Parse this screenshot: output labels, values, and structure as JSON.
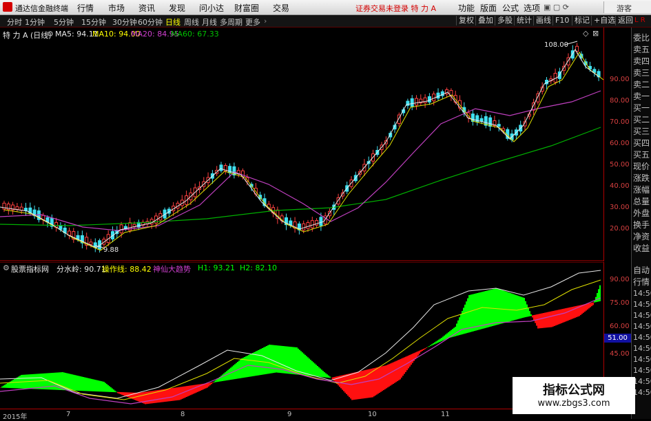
{
  "menubar": {
    "app_title": "通达信金融终端",
    "menus": [
      "行情",
      "市场",
      "资讯",
      "发现",
      "问小达",
      "财富圈",
      "交易"
    ],
    "notice": "证券交易未登录  特 力 A",
    "right_menus": [
      "功能",
      "版面",
      "公式",
      "选项"
    ],
    "guest": "游客"
  },
  "toolbar": {
    "periods": [
      "分时",
      "1分钟",
      "5分钟",
      "15分钟",
      "30分钟",
      "60分钟",
      "日线",
      "周线",
      "月线",
      "多周期",
      "更多"
    ],
    "active_period": "日线",
    "right_buttons": [
      "复权",
      "叠加",
      "多股",
      "统计",
      "画线",
      "F10",
      "标记",
      "+自选",
      "返回"
    ]
  },
  "main_chart": {
    "stock": "特 力 A (日线)",
    "ma": [
      {
        "label": "MA5: 94.11",
        "color": "#e8e8e8"
      },
      {
        "label": "MA10: 94.00",
        "color": "#ffff00"
      },
      {
        "label": "MA20: 84.95",
        "color": "#d040d0"
      },
      {
        "label": "MA60: 67.33",
        "color": "#00c000"
      }
    ],
    "high_label": "108.00",
    "low_label": "9.88",
    "y_ticks": [
      "90.00",
      "80.00",
      "70.00",
      "60.00",
      "50.00",
      "40.00",
      "30.00",
      "20.00"
    ]
  },
  "indicator": {
    "name": "股票指标网",
    "labels": [
      {
        "label": "分水岭: 90.71",
        "color": "#e8e8e8"
      },
      {
        "label": "操作线: 88.42",
        "color": "#ffff00"
      },
      {
        "label": "神仙大趋势",
        "color": "#d040d0"
      },
      {
        "label": "H1: 93.21",
        "color": "#00ff00"
      },
      {
        "label": "H2: 82.10",
        "color": "#00ff00"
      }
    ],
    "y_ticks": [
      "90.00",
      "75.00",
      "60.00",
      "45.00"
    ],
    "current_value": "51.00"
  },
  "date_axis": [
    "2015年",
    "7",
    "8",
    "9",
    "10",
    "11"
  ],
  "side_panel": {
    "header": "L R",
    "items": [
      "委比",
      "卖五",
      "卖四",
      "卖三",
      "卖二",
      "卖一",
      "买一",
      "买二",
      "买三",
      "买四",
      "买五",
      "现价",
      "涨跌",
      "涨幅",
      "总量",
      "外盘",
      "换手",
      "净资",
      "收益",
      "自动",
      "行情"
    ],
    "times": [
      "14:50",
      "14:50",
      "14:50",
      "14:50",
      "14:50",
      "14:50",
      "14:50",
      "14:50",
      "14:50",
      "14:50"
    ]
  },
  "watermark": {
    "title": "指标公式网",
    "url": "www.zbgs3.com"
  }
}
